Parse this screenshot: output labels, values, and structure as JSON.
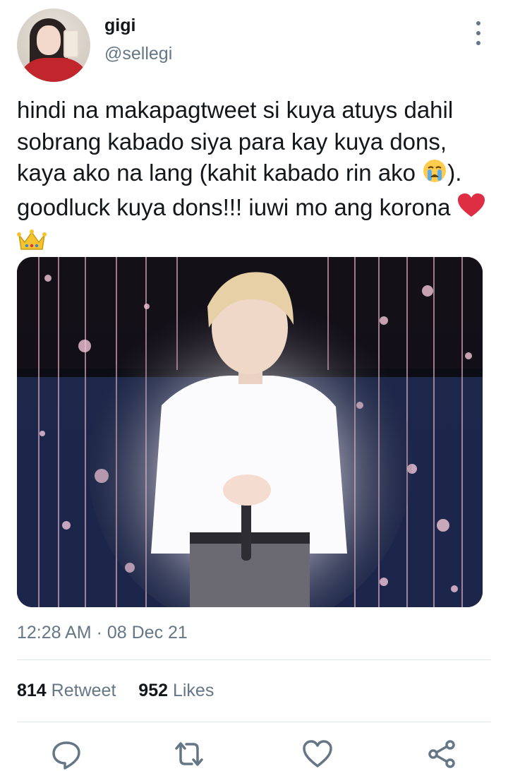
{
  "user": {
    "name": "gigi",
    "handle": "@sellegi"
  },
  "tweet": {
    "text": "hindi na makapagtweet si kuya atuys dahil sobrang kabado siya para kay kuya dons, kaya ako na lang (kahit kabado rin ako",
    "text_after_emoji": "). goodluck kuya dons!!! iuwi mo ang korona",
    "emojis": [
      "crying-face",
      "red-heart",
      "crown"
    ]
  },
  "meta": {
    "time": "12:28 AM",
    "separator": "·",
    "date": "08 Dec 21"
  },
  "stats": {
    "retweets": "814",
    "retweets_label": "Retweet",
    "likes": "952",
    "likes_label": "Likes"
  },
  "actions": [
    "reply-icon",
    "retweet-icon",
    "like-icon",
    "share-icon"
  ],
  "colors": {
    "text": "#14171a",
    "secondary": "#657786",
    "divider": "#e1e8ed"
  }
}
